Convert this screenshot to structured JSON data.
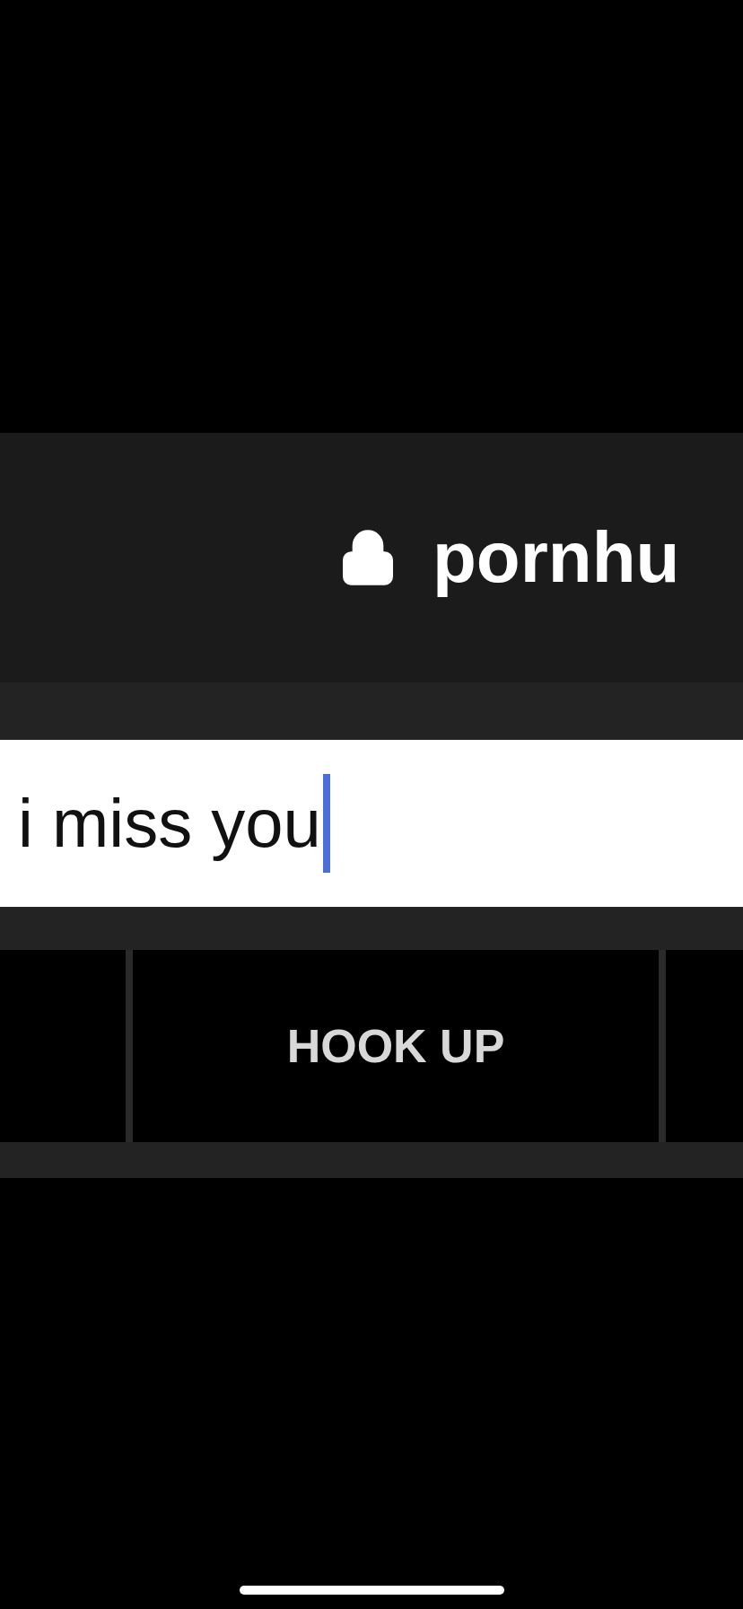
{
  "address_bar": {
    "url": "pornhu"
  },
  "search": {
    "value": "i miss you"
  },
  "tabs": [
    {
      "kind": "partial"
    },
    {
      "label": "HOOK UP",
      "kind": "full"
    },
    {
      "kind": "partial"
    }
  ]
}
